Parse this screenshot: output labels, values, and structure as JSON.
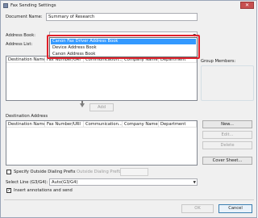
{
  "window": {
    "title": "Fax Sending Settings",
    "close_glyph": "✕",
    "app_icon": "fax-app-icon"
  },
  "document_name": {
    "label": "Document Name:",
    "value": "Summary of Research"
  },
  "address_book": {
    "label": "Address Book:",
    "selected": "Canon Fax Driver Address Book",
    "options": [
      "Canon Fax Driver Address Book",
      "Device Address Book",
      "Canon Address Book"
    ]
  },
  "address_list": {
    "label": "Address List:",
    "columns": [
      "Destination Name",
      "Fax Number/URI",
      "Communication...",
      "Company Name",
      "Department"
    ]
  },
  "group_members": {
    "label": "Group Members:"
  },
  "add_button": "Add",
  "destination_address": {
    "label": "Destination Address",
    "columns": [
      "Destination Name",
      "Fax Number/URI",
      "Communication...",
      "Company Name",
      "Department"
    ]
  },
  "side_buttons": {
    "new": "New...",
    "edit": "Edit...",
    "delete": "Delete",
    "cover_sheet": "Cover Sheet..."
  },
  "dialing_prefix": {
    "checkbox_label": "Specify Outside Dialing Prefix",
    "checked": false,
    "field_label": "Outside Dialing Prefix:",
    "value": ""
  },
  "line": {
    "label": "Select Line (G3/G4):",
    "value": "Auto(G3/G4)"
  },
  "insert_annotations": {
    "label": "Insert annotations and send",
    "checked": true,
    "check_glyph": "✓"
  },
  "footer": {
    "ok": "OK",
    "cancel": "Cancel"
  },
  "colors": {
    "highlight": "#e0202a",
    "selection": "#3399ff",
    "close": "#c75050"
  }
}
